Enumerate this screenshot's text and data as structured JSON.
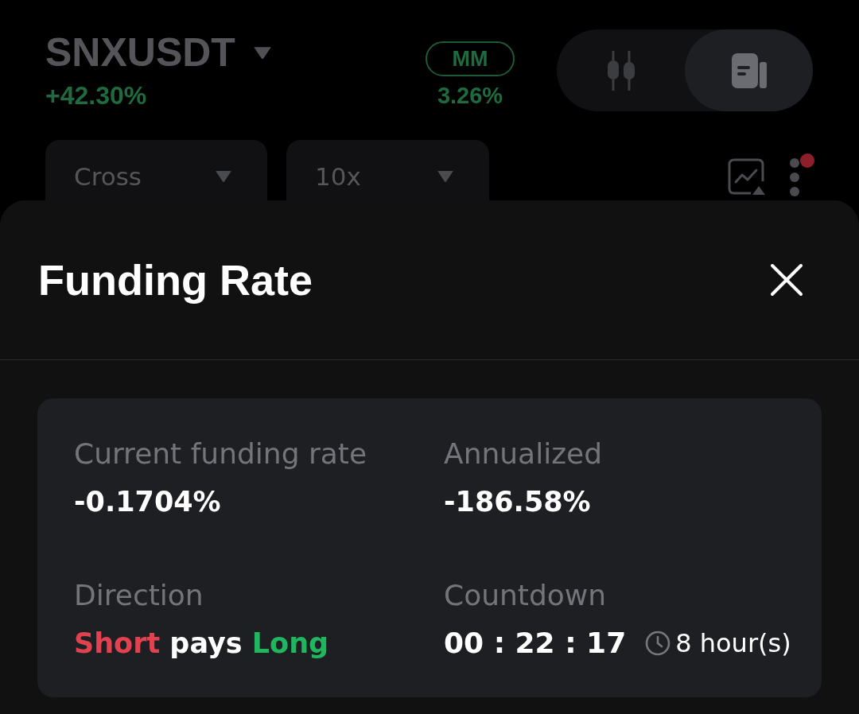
{
  "header": {
    "symbol": "SNXUSDT",
    "change": "+42.30%",
    "mm": {
      "label": "MM",
      "value": "3.26%"
    },
    "view_toggle": [
      {
        "kind": "candles",
        "selected": false
      },
      {
        "kind": "news",
        "selected": true
      }
    ],
    "dropdowns": [
      {
        "value": "Cross"
      },
      {
        "value": "10x"
      }
    ],
    "menu": {
      "notification_dot": true
    }
  },
  "sheet": {
    "title": "Funding Rate",
    "stats": [
      {
        "kind": "plain",
        "label": "Current funding rate",
        "value": "-0.1704%"
      },
      {
        "kind": "plain",
        "label": "Annualized",
        "value": "-186.58%"
      },
      {
        "kind": "direction",
        "label": "Direction",
        "payer": "Short",
        "verb": "pays",
        "receiver": "Long"
      },
      {
        "kind": "countdown",
        "label": "Countdown",
        "value": "00 : 22 : 17",
        "interval": "8 hour(s)"
      }
    ]
  }
}
